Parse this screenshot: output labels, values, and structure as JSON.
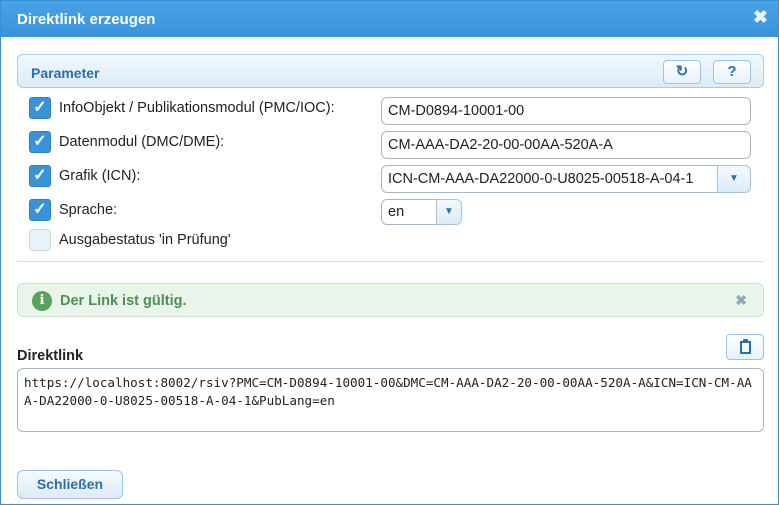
{
  "dialog": {
    "title": "Direktlink erzeugen",
    "close_glyph": "✖"
  },
  "parameter": {
    "header": "Parameter",
    "refresh_icon": "↻",
    "help_label": "?",
    "rows": [
      {
        "checked": true,
        "label": "InfoObjekt / Publikationsmodul (PMC/IOC):",
        "value": "CM-D0894-10001-00"
      },
      {
        "checked": true,
        "label": "Datenmodul (DMC/DME):",
        "value": "CM-AAA-DA2-20-00-00AA-520A-A"
      },
      {
        "checked": true,
        "label": "Grafik (ICN):",
        "value": "ICN-CM-AAA-DA22000-0-U8025-00518-A-04-1"
      },
      {
        "checked": true,
        "label": "Sprache:",
        "value": "en"
      },
      {
        "checked": false,
        "label": "Ausgabestatus 'in Prüfung'"
      }
    ]
  },
  "alert": {
    "icon": "i",
    "message": "Der Link ist gültig.",
    "dismiss": "✖"
  },
  "direktlink": {
    "label": "Direktlink",
    "clipboard_icon": "clipboard-icon",
    "value": "https://localhost:8002/rsiv?PMC=CM-D0894-10001-00&DMC=CM-AAA-DA2-20-00-00AA-520A-A&ICN=ICN-CM-AAA-DA22000-0-U8025-00518-A-04-1&PubLang=en"
  },
  "footer": {
    "close_button": "Schließen"
  },
  "colors": {
    "accent": "#3a92d8",
    "success_bg": "#e9f5ea",
    "success_text": "#4e8f54"
  }
}
